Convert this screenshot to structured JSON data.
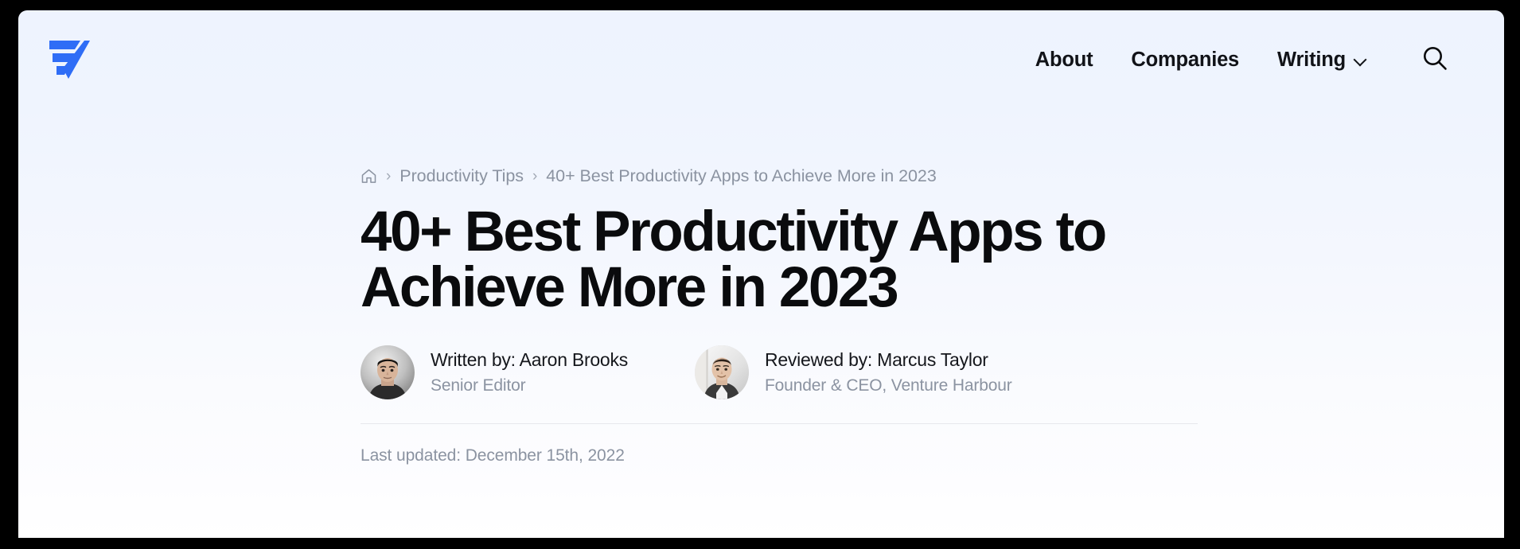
{
  "theme": {
    "brand_color": "#2f6df6",
    "bg_top": "#eef3fe",
    "bg_bottom": "#ffffff",
    "text_primary": "#0a0b0d",
    "text_muted": "#8b93a1",
    "divider": "#e6e8ed",
    "frame": "#000000"
  },
  "header": {
    "logo_name": "venture-harbour-logo",
    "nav": [
      {
        "label": "About",
        "has_dropdown": false
      },
      {
        "label": "Companies",
        "has_dropdown": false
      },
      {
        "label": "Writing",
        "has_dropdown": true
      }
    ],
    "search_icon": "search-icon"
  },
  "breadcrumb": {
    "home_icon": "home-icon",
    "separator": "›",
    "items": [
      {
        "label": "Productivity Tips",
        "is_current": false
      },
      {
        "label": "40+ Best Productivity Apps to Achieve More in 2023",
        "is_current": true
      }
    ]
  },
  "article": {
    "title": "40+ Best Productivity Apps to Achieve More in 2023",
    "bylines": [
      {
        "avatar_name": "author-avatar",
        "name": "Written by: Aaron Brooks",
        "role": "Senior Editor"
      },
      {
        "avatar_name": "reviewer-avatar",
        "name": "Reviewed by: Marcus Taylor",
        "role": "Founder & CEO, Venture Harbour"
      }
    ],
    "last_updated": "Last updated: December 15th, 2022"
  }
}
